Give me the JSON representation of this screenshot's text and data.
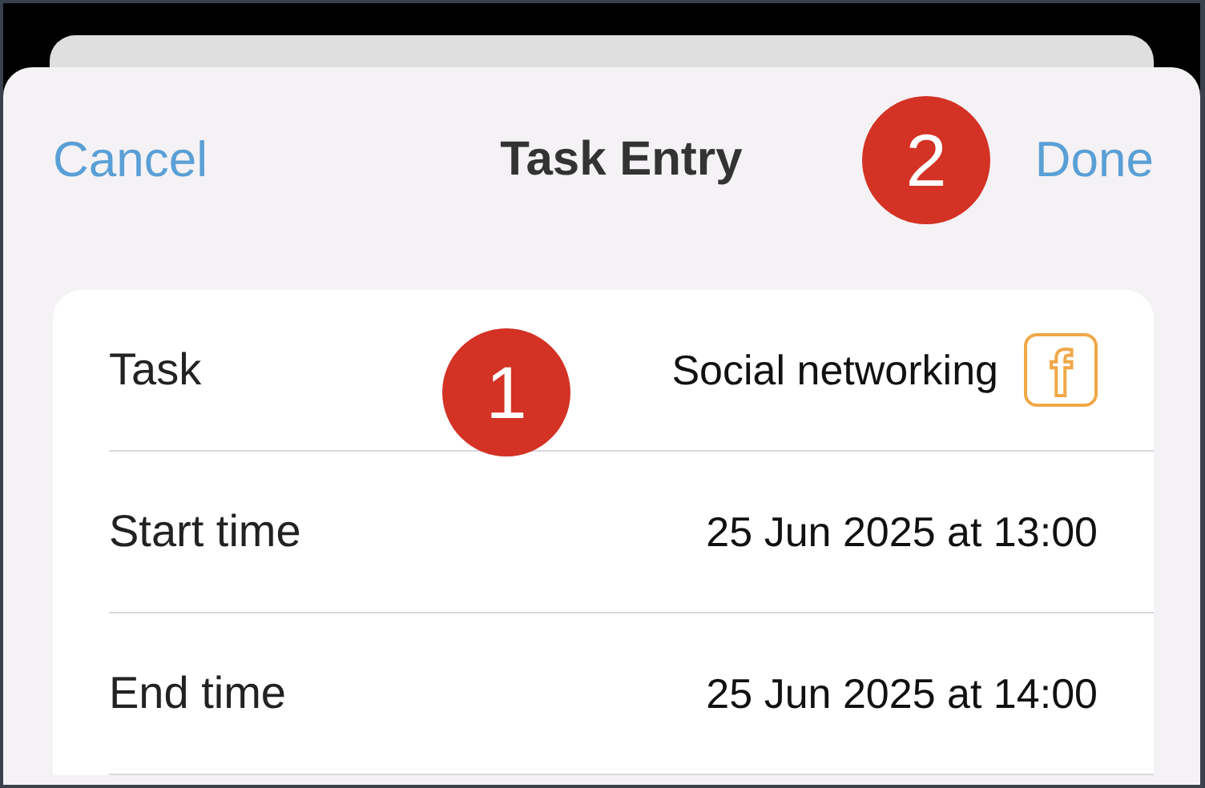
{
  "nav": {
    "cancel": "Cancel",
    "title": "Task Entry",
    "done": "Done",
    "callout": "2"
  },
  "rows": [
    {
      "kind": "task",
      "label": "Task",
      "value": "Social networking",
      "icon_glyph": "f",
      "callout": "1"
    },
    {
      "kind": "time",
      "label": "Start time",
      "value": "25 Jun 2025 at 13:00"
    },
    {
      "kind": "time",
      "label": "End time",
      "value": "25 Jun 2025 at 14:00"
    }
  ]
}
